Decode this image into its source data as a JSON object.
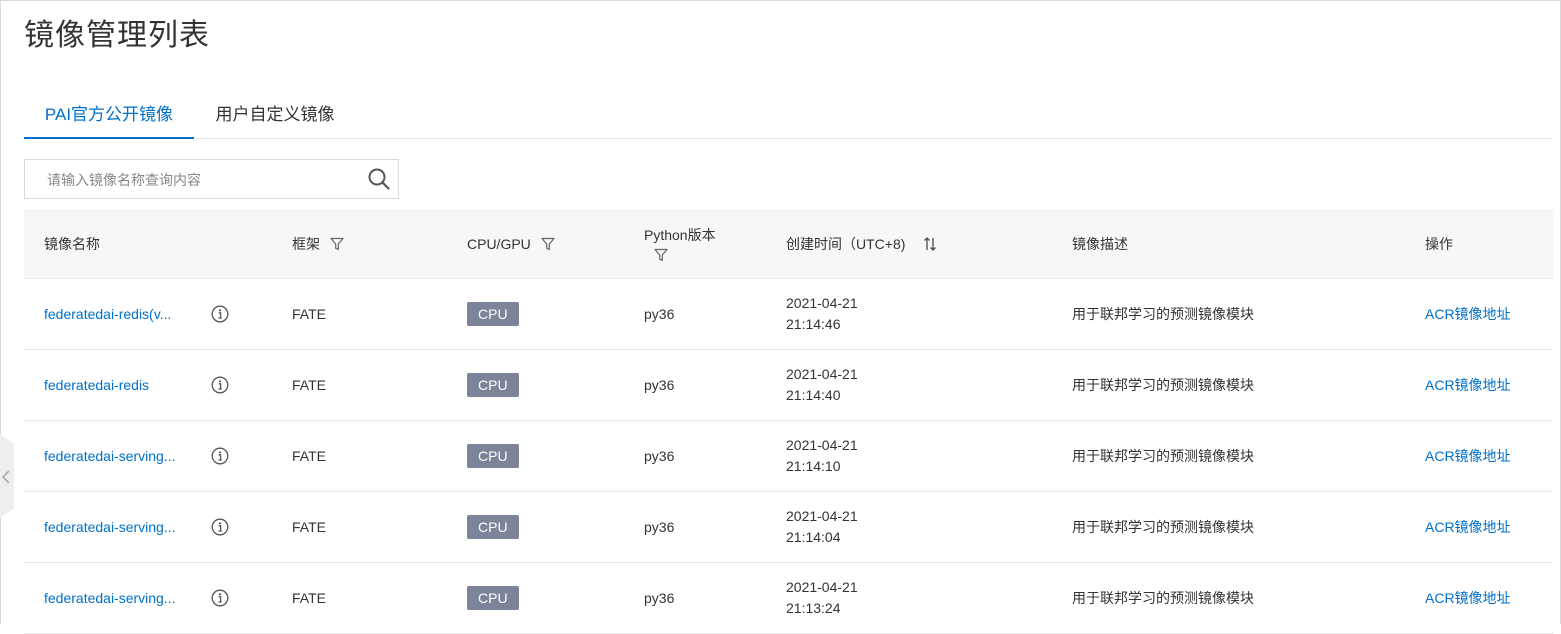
{
  "page": {
    "title": "镜像管理列表"
  },
  "tabs": [
    {
      "label": "PAI官方公开镜像",
      "active": true
    },
    {
      "label": "用户自定义镜像",
      "active": false
    }
  ],
  "search": {
    "placeholder": "请输入镜像名称查询内容",
    "value": ""
  },
  "table": {
    "headers": {
      "name": "镜像名称",
      "framework": "框架",
      "processor": "CPU/GPU",
      "python": "Python版本",
      "created": "创建时间（UTC+8)",
      "description": "镜像描述",
      "action": "操作"
    },
    "rows": [
      {
        "name": "federatedai-redis(v...",
        "framework": "FATE",
        "processor": "CPU",
        "python": "py36",
        "date": "2021-04-21",
        "time": "21:14:46",
        "description": "用于联邦学习的预测镜像模块",
        "action": "ACR镜像地址"
      },
      {
        "name": "federatedai-redis",
        "framework": "FATE",
        "processor": "CPU",
        "python": "py36",
        "date": "2021-04-21",
        "time": "21:14:40",
        "description": "用于联邦学习的预测镜像模块",
        "action": "ACR镜像地址"
      },
      {
        "name": "federatedai-serving...",
        "framework": "FATE",
        "processor": "CPU",
        "python": "py36",
        "date": "2021-04-21",
        "time": "21:14:10",
        "description": "用于联邦学习的预测镜像模块",
        "action": "ACR镜像地址"
      },
      {
        "name": "federatedai-serving...",
        "framework": "FATE",
        "processor": "CPU",
        "python": "py36",
        "date": "2021-04-21",
        "time": "21:14:04",
        "description": "用于联邦学习的预测镜像模块",
        "action": "ACR镜像地址"
      },
      {
        "name": "federatedai-serving...",
        "framework": "FATE",
        "processor": "CPU",
        "python": "py36",
        "date": "2021-04-21",
        "time": "21:13:24",
        "description": "用于联邦学习的预测镜像模块",
        "action": "ACR镜像地址"
      }
    ]
  },
  "colors": {
    "accent": "#0070cc",
    "badge": "#7d8398",
    "header_bg": "#f7f7f7"
  },
  "icons": {
    "search": "search-icon",
    "filter": "filter-icon",
    "sort": "sort-icon",
    "info": "info-icon",
    "collapse": "chevron-left-icon"
  }
}
